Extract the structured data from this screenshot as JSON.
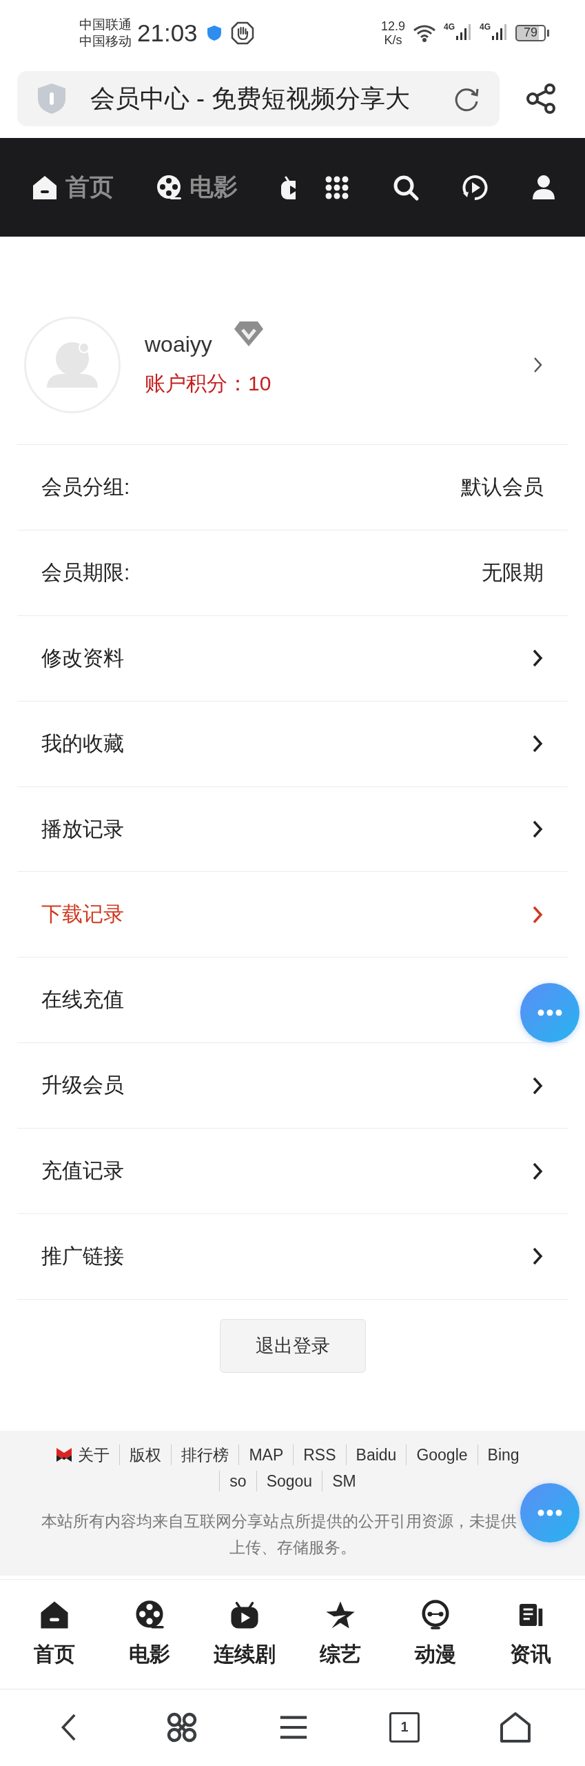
{
  "status_bar": {
    "carrier_1": "中国联通",
    "carrier_2": "中国移动",
    "time": "21:03",
    "speed_value": "12.9",
    "speed_unit": "K/s",
    "network_1": "4G",
    "network_2": "4G",
    "battery": "79"
  },
  "address_bar": {
    "title": "会员中心 - 免费短视频分享大"
  },
  "top_nav": [
    {
      "kind": "home",
      "label": "首页"
    },
    {
      "kind": "film",
      "label": "电影"
    },
    {
      "kind": "tv-cut"
    },
    {
      "kind": "grid"
    },
    {
      "kind": "search"
    },
    {
      "kind": "history"
    },
    {
      "kind": "user"
    }
  ],
  "profile": {
    "username": "woaiyy",
    "points_label": "账户积分：",
    "points": "10"
  },
  "rows": [
    {
      "kind": "value",
      "label": "会员分组:",
      "value": "默认会员"
    },
    {
      "kind": "value",
      "label": "会员期限:",
      "value": "无限期"
    },
    {
      "kind": "link",
      "label": "修改资料",
      "active": false
    },
    {
      "kind": "link",
      "label": "我的收藏",
      "active": false
    },
    {
      "kind": "link",
      "label": "播放记录",
      "active": false
    },
    {
      "kind": "link",
      "label": "下载记录",
      "active": true
    },
    {
      "kind": "link",
      "label": "在线充值",
      "active": false
    },
    {
      "kind": "link",
      "label": "升级会员",
      "active": false
    },
    {
      "kind": "link",
      "label": "充值记录",
      "active": false
    },
    {
      "kind": "link",
      "label": "推广链接",
      "active": false
    }
  ],
  "logout_button": "退出登录",
  "footer": {
    "links": [
      "关于",
      "版权",
      "排行榜",
      "MAP",
      "RSS",
      "Baidu",
      "Google",
      "Bing",
      "so",
      "Sogou",
      "SM"
    ],
    "notice_line_1": "本站所有内容均来自互联网分享站点所提供的公开引用资源，未提供",
    "notice_line_2": "上传、存储服务。"
  },
  "bottom_tabs": [
    {
      "kind": "home",
      "label": "首页"
    },
    {
      "kind": "film",
      "label": "电影"
    },
    {
      "kind": "tv",
      "label": "连续剧"
    },
    {
      "kind": "star",
      "label": "综艺"
    },
    {
      "kind": "anime",
      "label": "动漫"
    },
    {
      "kind": "news",
      "label": "资讯"
    }
  ],
  "system_nav": [
    {
      "kind": "back"
    },
    {
      "kind": "command"
    },
    {
      "kind": "menu"
    },
    {
      "kind": "tabs",
      "count": "1"
    },
    {
      "kind": "home"
    }
  ]
}
